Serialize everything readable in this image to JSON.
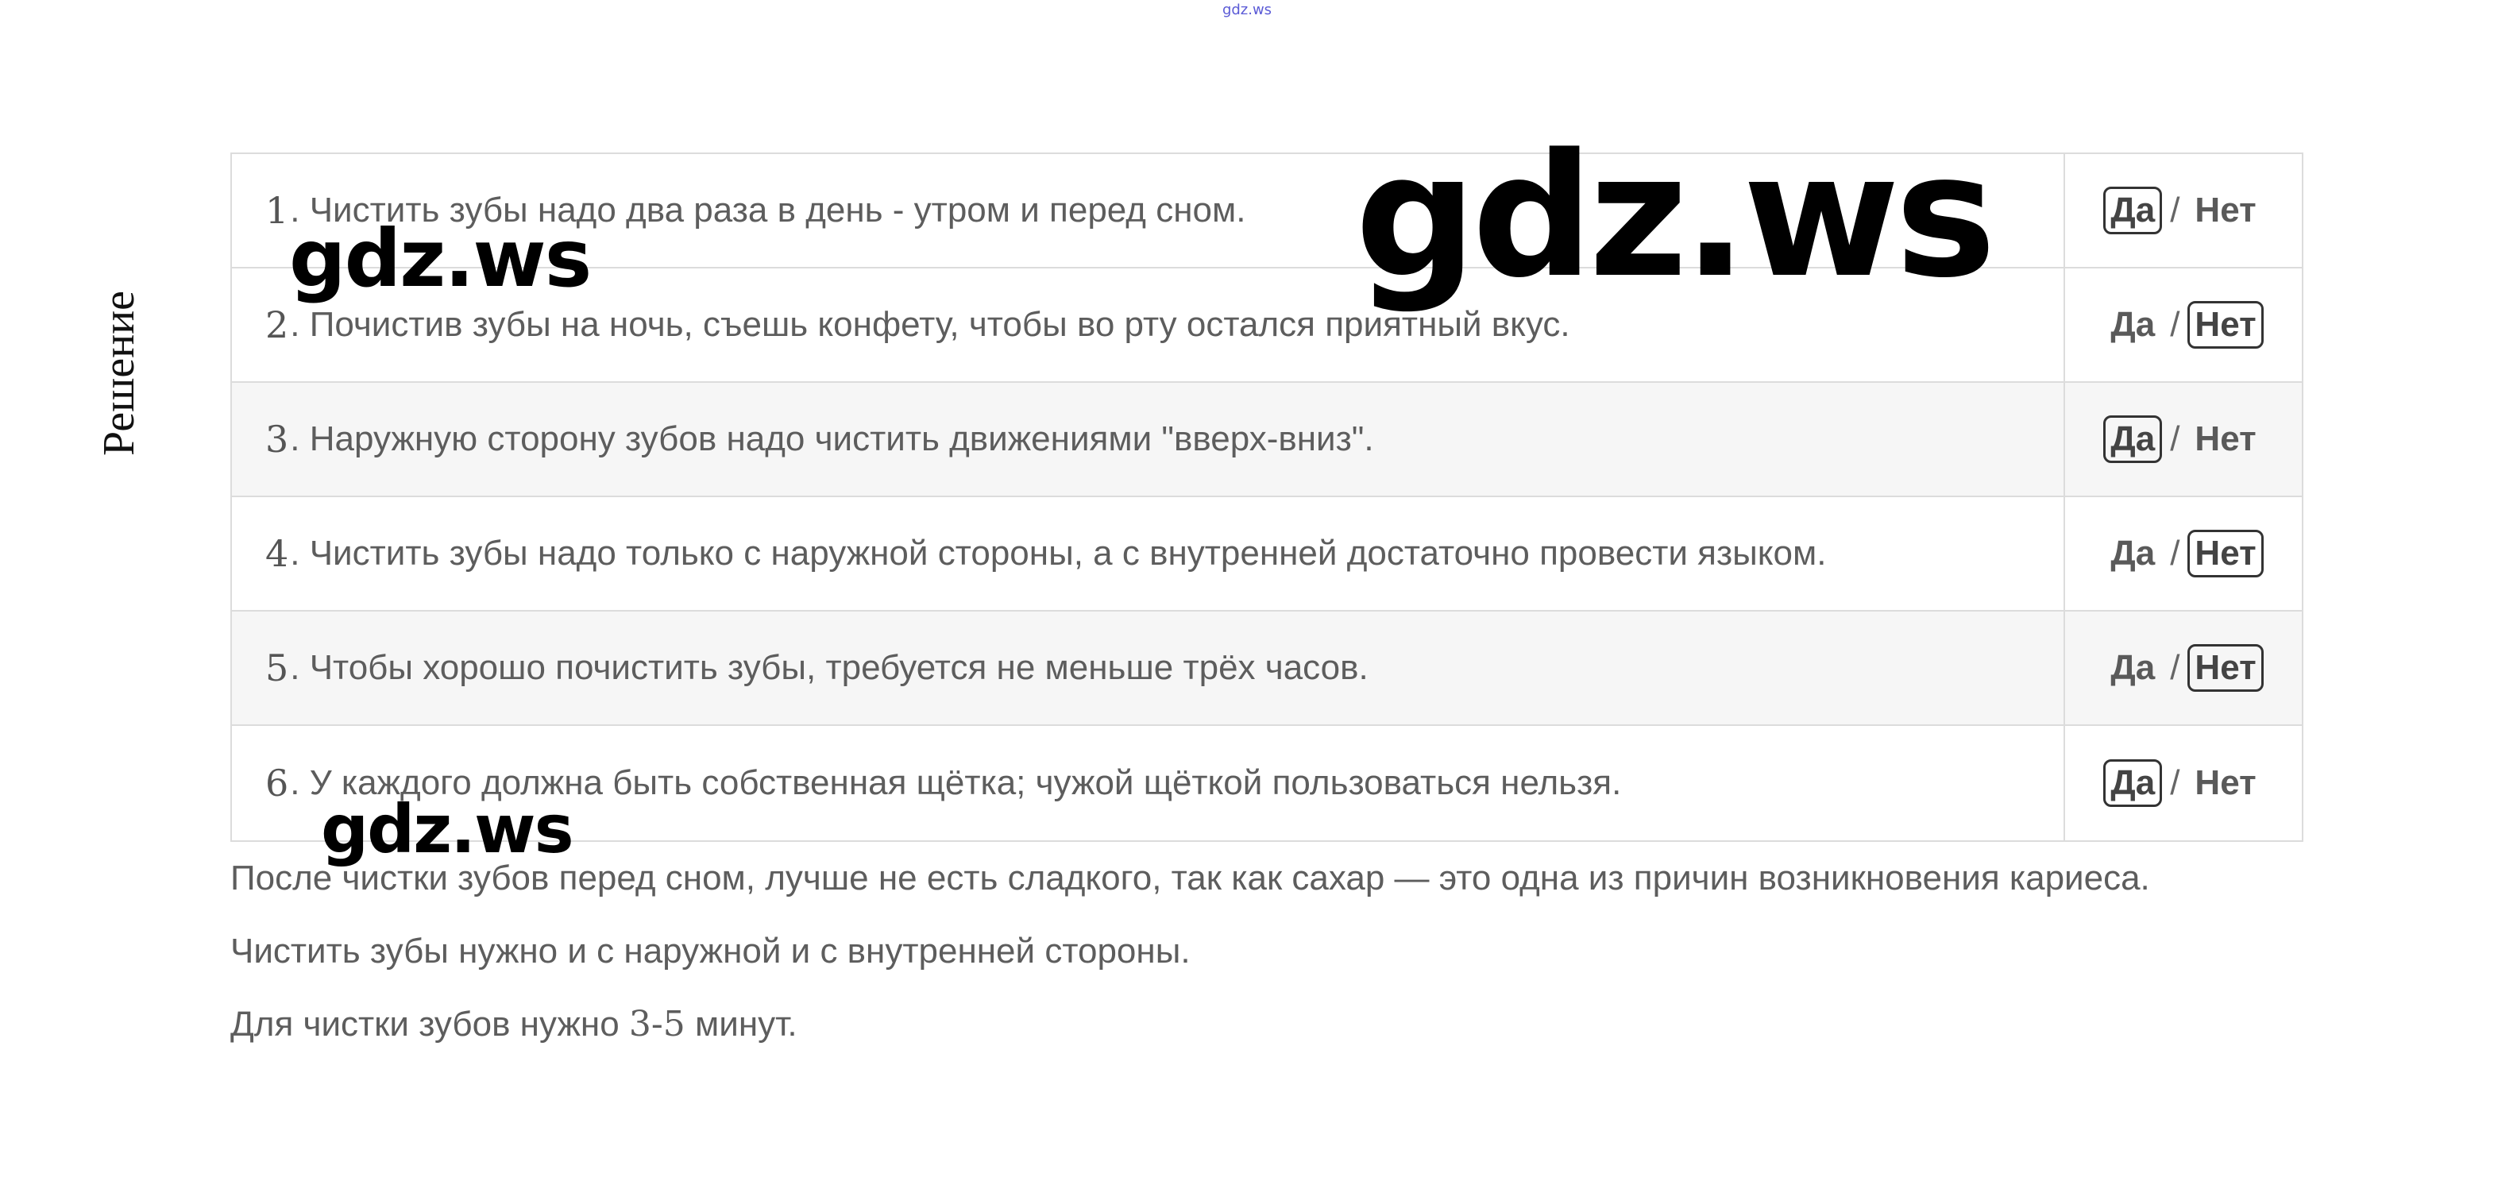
{
  "header_mark": "gdz.ws",
  "side_label": "Решение",
  "questions": [
    {
      "num": "1",
      "text": ". Чистить зубы надо два раза в день - утром и перед сном.",
      "yes": "Да",
      "no": "Нет",
      "selected": "yes"
    },
    {
      "num": "2",
      "text": ". Почистив зубы на ночь, съешь конфету, чтобы во рту остался приятный вкус.",
      "yes": "Да",
      "no": "Нет",
      "selected": "no"
    },
    {
      "num": "3",
      "text": ". Наружную сторону зубов надо чистить движениями \"вверх-вниз\".",
      "yes": "Да",
      "no": "Нет",
      "selected": "yes"
    },
    {
      "num": "4",
      "text": ". Чистить зубы надо только с наружной стороны, а с внутренней достаточно провести языком.",
      "yes": "Да",
      "no": "Нет",
      "selected": "no"
    },
    {
      "num": "5",
      "text": ". Чтобы хорошо почистить зубы, требуется не меньше трёх часов.",
      "yes": "Да",
      "no": "Нет",
      "selected": "no"
    },
    {
      "num": "6",
      "text": ". У каждого должна быть собственная щётка; чужой щёткой пользоваться нельзя.",
      "yes": "Да",
      "no": "Нет",
      "selected": "yes"
    }
  ],
  "separator": "/",
  "notes": {
    "line1": "После чистки зубов перед сном, лучше не есть сладкого, так как сахар — это одна из причин возникновения кариеса.",
    "line2": "Чистить зубы нужно и с наружной и с внутренней стороны.",
    "line3_prefix": "Для чистки зубов нужно ",
    "line3_value": "3-5",
    "line3_suffix": " минут."
  },
  "watermarks": {
    "big": "gdz.ws",
    "small_a": "gdz.ws",
    "small_b": "gdz.ws"
  }
}
